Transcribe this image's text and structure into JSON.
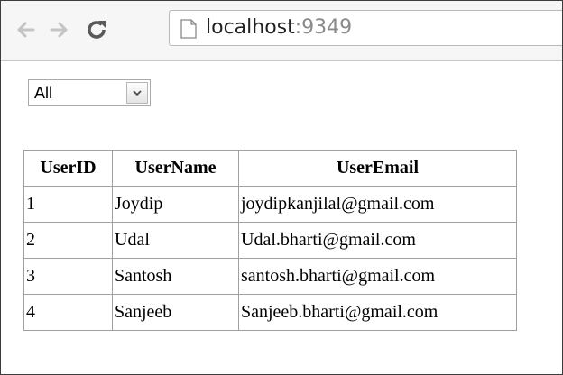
{
  "browser": {
    "back_icon": "arrow-left-icon",
    "forward_icon": "arrow-right-icon",
    "reload_icon": "reload-icon",
    "page_icon": "document-icon",
    "url_host": "localhost",
    "url_port": ":9349"
  },
  "filter": {
    "selected": "All",
    "arrow_icon": "chevron-down-icon"
  },
  "table": {
    "headers": [
      "UserID",
      "UserName",
      "UserEmail"
    ],
    "rows": [
      [
        "1",
        "Joydip",
        "joydipkanjilal@gmail.com"
      ],
      [
        "2",
        "Udal",
        "Udal.bharti@gmail.com"
      ],
      [
        "3",
        "Santosh",
        "santosh.bharti@gmail.com"
      ],
      [
        "4",
        "Sanjeeb",
        "Sanjeeb.bharti@gmail.com"
      ]
    ]
  },
  "colors": {
    "toolbar_bg": "#f6f6f6",
    "nav_icon_disabled": "#c4c4c4",
    "reload_icon": "#5a5a5a",
    "table_border": "#a0a0a0"
  }
}
